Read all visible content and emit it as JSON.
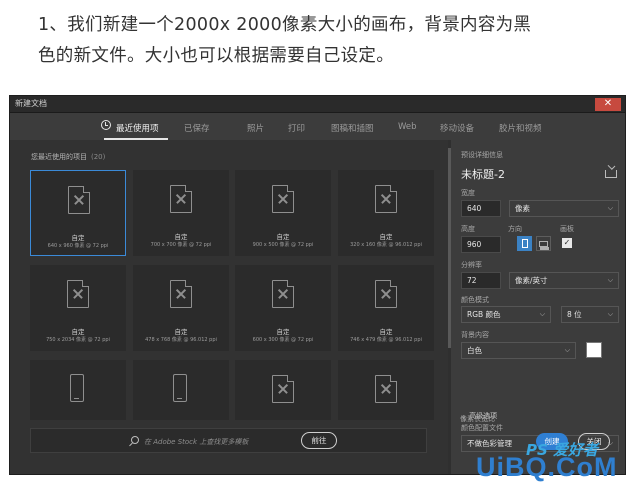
{
  "instruction": {
    "line1": "1、我们新建一个2000x 2000像素大小的画布，背景内容为黑",
    "line2": "色的新文件。大小也可以根据需要自己设定。"
  },
  "window": {
    "title": "新建文档",
    "close_label": "✕"
  },
  "tabs": [
    {
      "label": "最近使用项",
      "active": true
    },
    {
      "label": "已保存"
    },
    {
      "label": "照片"
    },
    {
      "label": "打印"
    },
    {
      "label": "图稿和插图"
    },
    {
      "label": "Web"
    },
    {
      "label": "移动设备"
    },
    {
      "label": "胶片和视频"
    }
  ],
  "recent": {
    "title": "您最近使用的项目",
    "count": "(20)",
    "presets": [
      {
        "name": "自定",
        "size": "640 x 960 像素 @ 72 ppi",
        "selected": true,
        "icon": "document-icon"
      },
      {
        "name": "自定",
        "size": "700 x 700 像素 @ 72 ppi",
        "icon": "document-icon"
      },
      {
        "name": "自定",
        "size": "900 x 500 像素 @ 72 ppi",
        "icon": "document-icon"
      },
      {
        "name": "自定",
        "size": "320 x 160 像素 @ 96.012 ppi",
        "icon": "document-icon"
      },
      {
        "name": "自定",
        "size": "750 x 2034 像素 @ 72 ppi",
        "icon": "document-icon"
      },
      {
        "name": "自定",
        "size": "478 x 768 像素 @ 96.012 ppi",
        "icon": "document-icon"
      },
      {
        "name": "自定",
        "size": "600 x 300 像素 @ 72 ppi",
        "icon": "document-icon"
      },
      {
        "name": "自定",
        "size": "746 x 479 像素 @ 96.012 ppi",
        "icon": "document-icon"
      },
      {
        "name": "",
        "size": "",
        "icon": "phone-icon"
      },
      {
        "name": "",
        "size": "",
        "icon": "phone-icon"
      },
      {
        "name": "",
        "size": "",
        "icon": "document-icon"
      },
      {
        "name": "",
        "size": "",
        "icon": "document-icon"
      }
    ]
  },
  "search": {
    "placeholder": "在 Adobe Stock 上查找更多模板",
    "go_label": "前往"
  },
  "details": {
    "header": "预设详细信息",
    "doc_name": "未标题-2",
    "width_label": "宽度",
    "width_value": "640",
    "width_unit": "像素",
    "height_label": "高度",
    "height_value": "960",
    "orientation_label": "方向",
    "artboard_label": "画板",
    "artboard_checked": "✓",
    "resolution_label": "分辨率",
    "resolution_value": "72",
    "resolution_unit": "像素/英寸",
    "color_mode_label": "颜色模式",
    "color_mode_value": "RGB 颜色",
    "bit_depth_value": "8 位",
    "background_label": "背景内容",
    "background_value": "白色",
    "background_swatch": "#ffffff",
    "advanced_label": "高级选项",
    "profile_label": "颜色配置文件",
    "profile_value": "不做色彩管理",
    "pixel_aspect_label": "像素长宽比"
  },
  "buttons": {
    "create": "创建",
    "close": "关闭"
  },
  "watermark": {
    "top": "PS 爱好者",
    "bottom": "UiBQ.CoM"
  },
  "colors": {
    "accent": "#2f7fd3",
    "selected_border": "#3b8ad8",
    "dialog_bg": "#3c3c3c",
    "grid_bg": "#323232"
  }
}
